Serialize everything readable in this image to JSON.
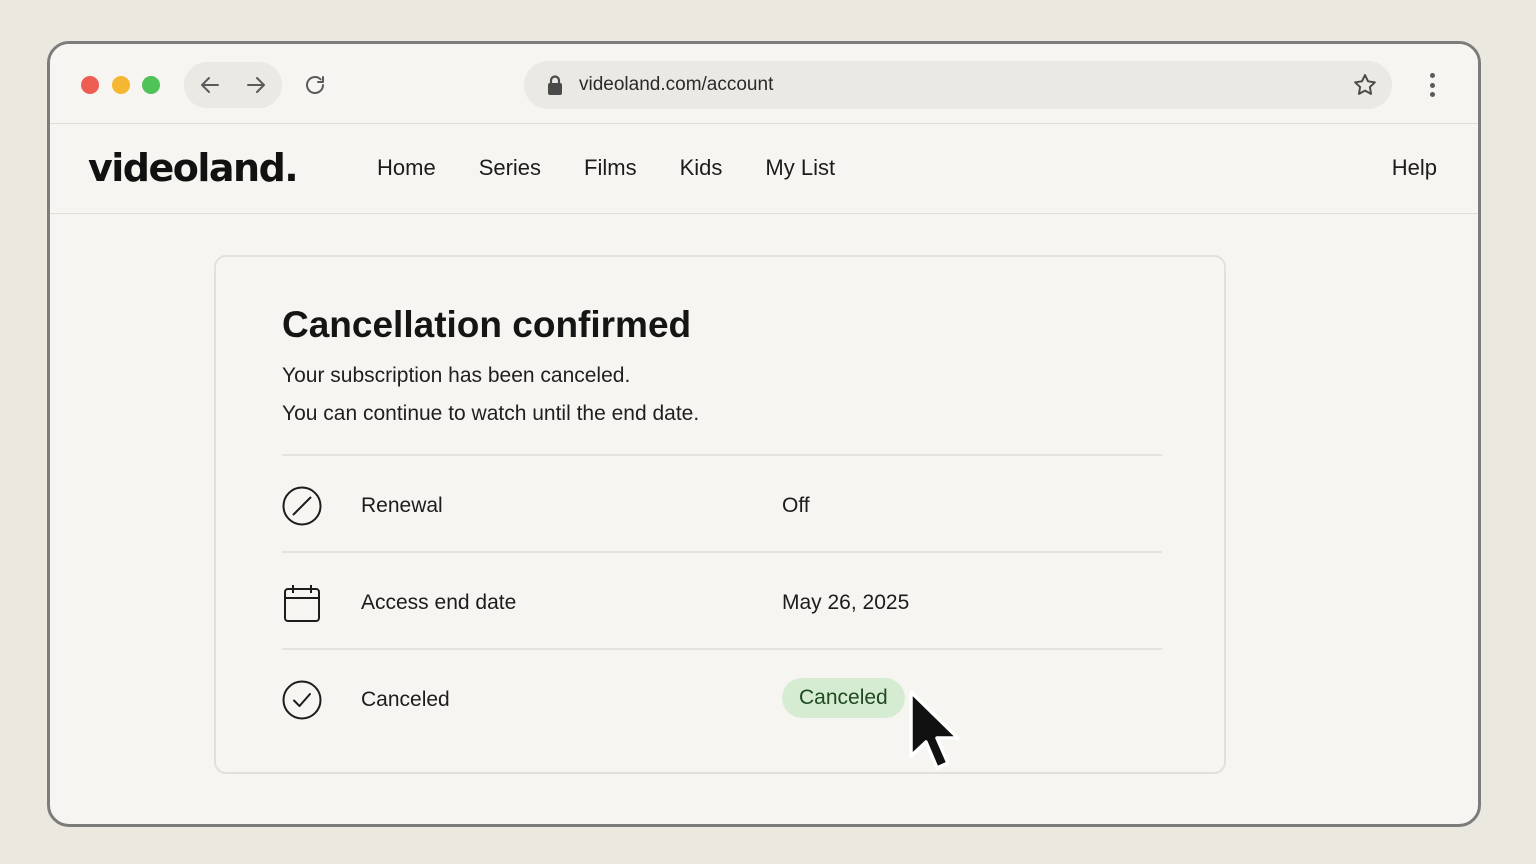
{
  "browser": {
    "url": "videoland.com/account",
    "icons": {
      "back": "arrow-left-icon",
      "forward": "arrow-right-icon",
      "reload": "reload-icon",
      "lock": "lock-icon",
      "bookmark": "star-icon",
      "menu": "kebab-menu-icon"
    },
    "colors": {
      "close": "#ee5d51",
      "minimize": "#f5b731",
      "maximize": "#4fc258"
    }
  },
  "site": {
    "logo": "videoland.",
    "nav": [
      "Home",
      "Series",
      "Films",
      "Kids",
      "My List"
    ],
    "help": "Help"
  },
  "confirmation": {
    "title": "Cancellation confirmed",
    "line1": "Your subscription has been canceled.",
    "line2": "You can continue to watch until the end date.",
    "rows": [
      {
        "icon": "prohibited-icon",
        "label": "Renewal",
        "value": "Off"
      },
      {
        "icon": "calendar-icon",
        "label": "Access end date",
        "value": "May 26, 2025"
      },
      {
        "icon": "check-circle-icon",
        "label": "Canceled",
        "badge": "Canceled"
      }
    ],
    "badge_color": "#d6ecd2"
  }
}
